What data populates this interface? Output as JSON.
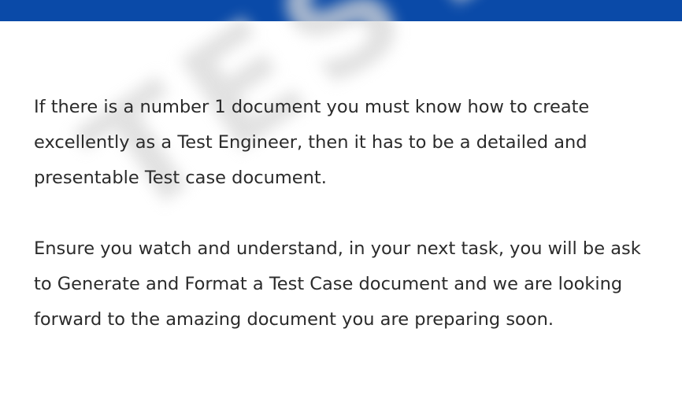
{
  "header": {
    "bar_color": "#0a4aa8"
  },
  "watermark": {
    "text": "TESTIFY"
  },
  "content": {
    "paragraph_1": {
      "line_1": "If there is a number 1 document you must know how to create",
      "line_2": "excellently as a Test Engineer, then it has to be a detailed and",
      "line_3": "presentable Test case document."
    },
    "paragraph_2": {
      "line_1": "Ensure you watch and understand, in your next task, you will be ask",
      "line_2": "to Generate and Format a Test Case document and we are looking",
      "line_3": "forward to the amazing document you are preparing soon."
    }
  }
}
